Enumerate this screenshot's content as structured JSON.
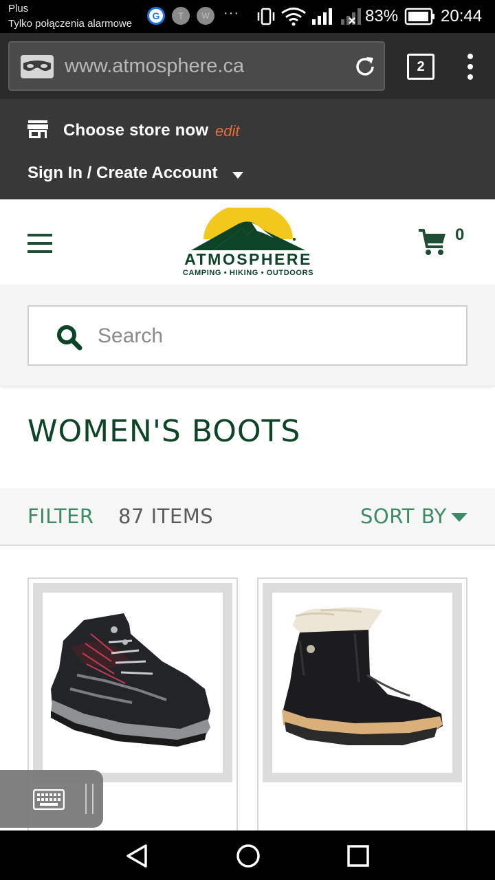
{
  "status_bar": {
    "carrier_line1": "Plus",
    "carrier_line2": "Tylko połączenia alarmowe",
    "notification_icons": [
      "google-icon",
      "t-icon",
      "w-icon"
    ],
    "notif_labels": [
      "G",
      "T",
      "W"
    ],
    "overflow": "···",
    "battery_percent": "83%",
    "time": "20:44"
  },
  "browser": {
    "url": "www.atmosphere.ca",
    "tab_count": "2"
  },
  "store_header": {
    "choose_store": "Choose store now",
    "edit": "edit",
    "sign_in": "Sign In / Create Account"
  },
  "logo": {
    "wordmark": "ATMOSPHERE",
    "tagline": "CAMPING • HIKING • OUTDOORS"
  },
  "cart": {
    "count": "0"
  },
  "search": {
    "placeholder": "Search"
  },
  "page": {
    "title": "WOMEN'S BOOTS"
  },
  "filter_bar": {
    "filter": "FILTER",
    "items": "87 ITEMS",
    "sort": "SORT BY"
  },
  "products": [
    {
      "image": "black-hiking-boot"
    },
    {
      "image": "black-winter-bootie-fur"
    }
  ],
  "colors": {
    "brand_green": "#0d4428",
    "accent_green": "#3d8a64",
    "edit_orange": "#e2703a",
    "logo_yellow": "#f2c81d",
    "header_dark": "#383838"
  }
}
